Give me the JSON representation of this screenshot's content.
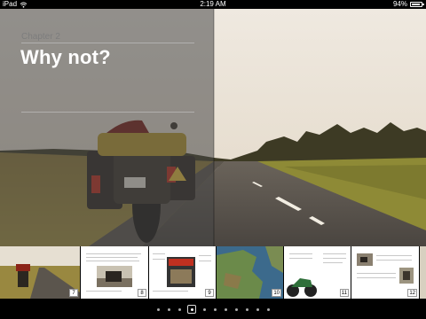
{
  "status_bar": {
    "device": "iPad",
    "time": "2:19 AM",
    "battery": "94%",
    "battery_level": 0.94,
    "icons": [
      "wifi-icon",
      "battery-icon"
    ]
  },
  "book": {
    "chapter_label": "Chapter 2",
    "chapter_title": "Why not?"
  },
  "thumbnails": [
    {
      "page": "7"
    },
    {
      "page": "8"
    },
    {
      "page": "9"
    },
    {
      "page": "10"
    },
    {
      "page": "11"
    },
    {
      "page": "12"
    }
  ],
  "pagination": {
    "total_dots": 11,
    "current_index": 3
  },
  "colors": {
    "overlay": "#464646",
    "title": "#ffffff",
    "chapter_label": "#7d7d7d",
    "sky": "#e9e4db",
    "field": "#9f8a3f",
    "road": "#4f4a44"
  }
}
